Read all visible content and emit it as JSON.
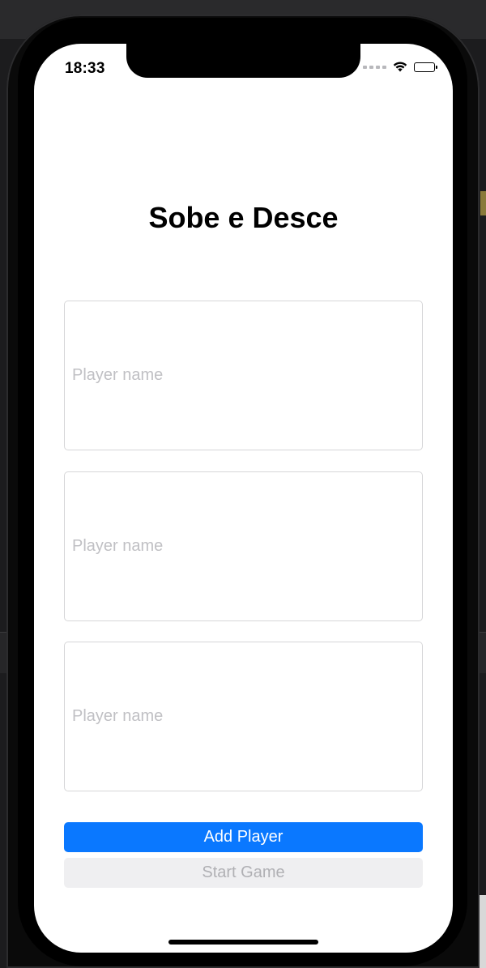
{
  "status_bar": {
    "time": "18:33",
    "icons": [
      "signal-icon",
      "wifi-icon",
      "battery-icon"
    ]
  },
  "app": {
    "title": "Sobe e Desce"
  },
  "players": [
    {
      "value": "",
      "placeholder": "Player name"
    },
    {
      "value": "",
      "placeholder": "Player name"
    },
    {
      "value": "",
      "placeholder": "Player name"
    }
  ],
  "actions": {
    "add_player_label": "Add Player",
    "start_game_label": "Start Game",
    "start_game_enabled": false
  },
  "colors": {
    "accent": "#0a78ff",
    "disabled_bg": "#efeff1",
    "disabled_text": "#b0b0b4",
    "placeholder": "#c0c0c4"
  }
}
